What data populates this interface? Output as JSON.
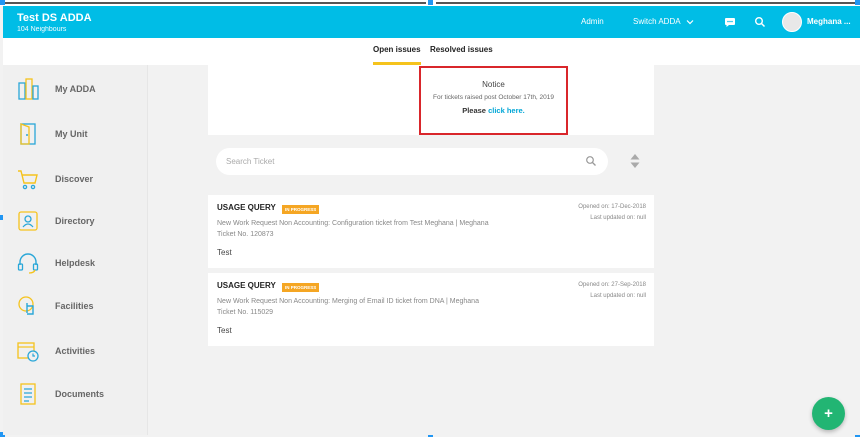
{
  "header": {
    "title": "Test DS ADDA",
    "subtitle": "104 Neighbours",
    "admin_label": "Admin",
    "switch_label": "Switch ADDA",
    "user_name": "Meghana ...",
    "color": "#00bde6"
  },
  "tabs": [
    {
      "label": "Open issues",
      "active": true
    },
    {
      "label": "Resolved issues",
      "active": false
    }
  ],
  "sidebar": {
    "items": [
      {
        "label": "My ADDA",
        "icon": "building-icon"
      },
      {
        "label": "My Unit",
        "icon": "door-icon"
      },
      {
        "label": "Discover",
        "icon": "cart-icon"
      },
      {
        "label": "Directory",
        "icon": "contact-card-icon"
      },
      {
        "label": "Helpdesk",
        "icon": "headset-icon"
      },
      {
        "label": "Facilities",
        "icon": "hand-pointer-icon"
      },
      {
        "label": "Activities",
        "icon": "calendar-clock-icon"
      },
      {
        "label": "Documents",
        "icon": "document-icon"
      }
    ]
  },
  "notice": {
    "title": "Notice",
    "text": "For tickets raised post October 17th, 2019",
    "cta_prefix": "Please",
    "cta_link": "click here."
  },
  "search": {
    "placeholder": "Search Ticket"
  },
  "tickets": [
    {
      "type": "USAGE QUERY",
      "status": "IN PROGRESS",
      "description": "New Work Request Non Accounting: Configuration ticket from Test Meghana | Meghana",
      "ticket_no": "Ticket No. 120873",
      "note": "Test",
      "opened": "Opened on: 17-Dec-2018",
      "updated": "Last updated on: null"
    },
    {
      "type": "USAGE QUERY",
      "status": "IN PROGRESS",
      "description": "New Work Request Non Accounting: Merging of Email ID ticket from DNA | Meghana",
      "ticket_no": "Ticket No. 115029",
      "note": "Test",
      "opened": "Opened on: 27-Sep-2018",
      "updated": "Last updated on: null"
    }
  ],
  "colors": {
    "accent": "#00bde6",
    "tab_underline": "#f5c31d",
    "badge": "#f5a623",
    "notice_border": "#d9262b",
    "fab": "#22b573"
  }
}
